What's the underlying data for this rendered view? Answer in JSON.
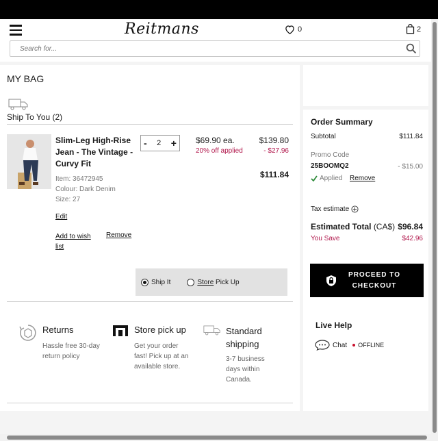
{
  "header": {
    "logo": "Reitmans",
    "wishlist_count": "0",
    "bag_count": "2",
    "search_placeholder": "Search for..."
  },
  "bag": {
    "title": "MY BAG",
    "ship_to_label": "Ship To You (2)"
  },
  "product": {
    "name": "Slim-Leg High-Rise Jean - The Vintage - Curvy Fit",
    "item": "Item: 36472945",
    "colour": "Colour: Dark Denim",
    "size": "Size: 27",
    "quantity": "2",
    "qty_minus": "-",
    "qty_plus": "+",
    "price_each": "$69.90 ea.",
    "discount_label": "20% off applied",
    "original_total": "$139.80",
    "discount_amount": "- $27.96",
    "line_total": "$111.84",
    "edit_label": "Edit",
    "wishlist_label": "Add to wish list",
    "remove_label": "Remove"
  },
  "shipping_options": {
    "ship_it": "Ship It",
    "store_label": "Store",
    "pick_up_label": "Pick Up",
    "selected": "ship_it"
  },
  "features": [
    {
      "title": "Returns",
      "text": "Hassle free 30-day return policy"
    },
    {
      "title": "Store pick up",
      "text": "Get your order fast! Pick up at an available store."
    },
    {
      "title": "Standard shipping",
      "text": "3-7 business days within Canada."
    }
  ],
  "order_summary": {
    "title": "Order Summary",
    "subtotal_label": "Subtotal",
    "subtotal_value": "$111.84",
    "promo_label": "Promo Code",
    "promo_code": "25BOOMQ2",
    "promo_value": "- $15.00",
    "applied_label": "Applied",
    "remove_label": "Remove",
    "tax_label": "Tax estimate",
    "estimated_total_label": "Estimated Total",
    "currency": "(CA$)",
    "estimated_total_value": "$96.84",
    "you_save_label": "You Save",
    "you_save_value": "$42.96",
    "proceed_label": "PROCEED TO CHECKOUT"
  },
  "live_help": {
    "title": "Live Help",
    "chat_label": "Chat",
    "status": "OFFLINE"
  },
  "colors": {
    "accent_pink": "#b0154a",
    "check_green": "#2e8b3a",
    "offline_red": "#c8102e"
  }
}
